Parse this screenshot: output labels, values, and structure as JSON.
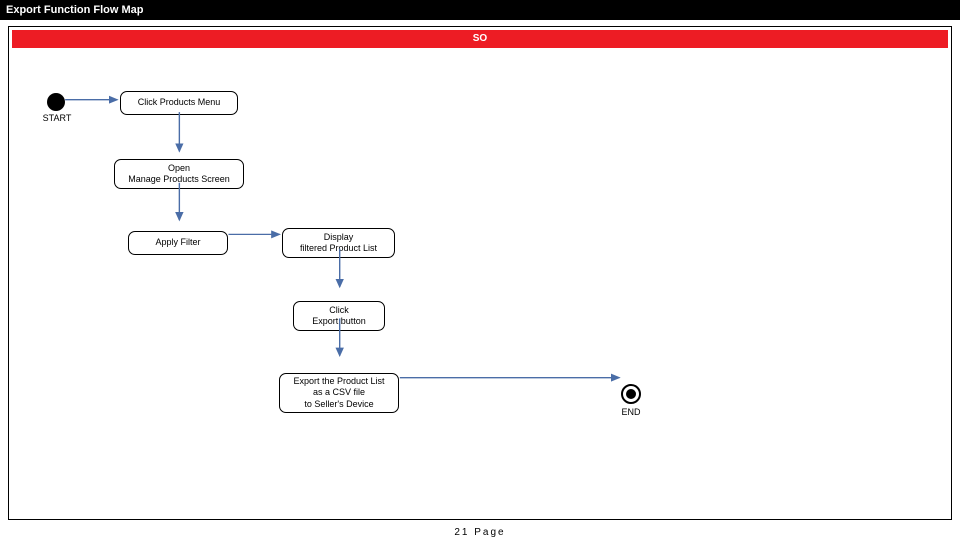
{
  "title": "Export Function Flow Map",
  "header_label": "SO",
  "footer": "21 Page",
  "nodes": {
    "start_label": "START",
    "end_label": "END",
    "n1": "Click Products Menu",
    "n2_l1": "Open",
    "n2_l2": "Manage Products Screen",
    "n3": "Apply Filter",
    "n4_l1": "Display",
    "n4_l2": "filtered Product List",
    "n5_l1": "Click",
    "n5_l2": "Export button",
    "n6_l1": "Export the Product List",
    "n6_l2": "as a CSV file",
    "n6_l3": "to Seller's Device"
  }
}
